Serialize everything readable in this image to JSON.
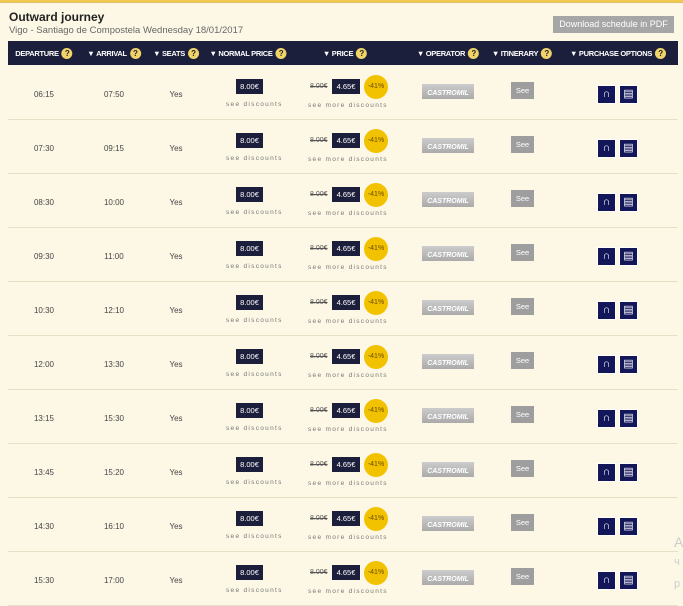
{
  "header": {
    "title": "Outward journey",
    "subtitle": "Vigo - Santiago de Compostela Wednesday 18/01/2017",
    "pdf_button": "Download schedule in PDF"
  },
  "columns": [
    "DEPARTURE",
    "ARRIVAL",
    "SEATS",
    "NORMAL PRICE",
    "PRICE",
    "OPERATOR",
    "ITINERARY",
    "PURCHASE OPTIONS"
  ],
  "help_glyph": "?",
  "rows": [
    {
      "departure": "06:15",
      "arrival": "07:50",
      "seats": "Yes",
      "normal_price": "8.00€",
      "old_price": "8.00€",
      "price": "4.65€",
      "discount": "-41%",
      "operator": "CASTROMIL",
      "itinerary": "See"
    },
    {
      "departure": "07:30",
      "arrival": "09:15",
      "seats": "Yes",
      "normal_price": "8.00€",
      "old_price": "8.00€",
      "price": "4.65€",
      "discount": "-41%",
      "operator": "CASTROMIL",
      "itinerary": "See"
    },
    {
      "departure": "08:30",
      "arrival": "10:00",
      "seats": "Yes",
      "normal_price": "8.00€",
      "old_price": "8.00€",
      "price": "4.65€",
      "discount": "-41%",
      "operator": "CASTROMIL",
      "itinerary": "See"
    },
    {
      "departure": "09:30",
      "arrival": "11:00",
      "seats": "Yes",
      "normal_price": "8.00€",
      "old_price": "8.00€",
      "price": "4.65€",
      "discount": "-41%",
      "operator": "CASTROMIL",
      "itinerary": "See"
    },
    {
      "departure": "10:30",
      "arrival": "12:10",
      "seats": "Yes",
      "normal_price": "8.00€",
      "old_price": "8.00€",
      "price": "4.65€",
      "discount": "-41%",
      "operator": "CASTROMIL",
      "itinerary": "See"
    },
    {
      "departure": "12:00",
      "arrival": "13:30",
      "seats": "Yes",
      "normal_price": "8.00€",
      "old_price": "8.00€",
      "price": "4.65€",
      "discount": "-41%",
      "operator": "CASTROMIL",
      "itinerary": "See"
    },
    {
      "departure": "13:15",
      "arrival": "15:30",
      "seats": "Yes",
      "normal_price": "8.00€",
      "old_price": "8.00€",
      "price": "4.65€",
      "discount": "-41%",
      "operator": "CASTROMIL",
      "itinerary": "See"
    },
    {
      "departure": "13:45",
      "arrival": "15:20",
      "seats": "Yes",
      "normal_price": "8.00€",
      "old_price": "8.00€",
      "price": "4.65€",
      "discount": "-41%",
      "operator": "CASTROMIL",
      "itinerary": "See"
    },
    {
      "departure": "14:30",
      "arrival": "16:10",
      "seats": "Yes",
      "normal_price": "8.00€",
      "old_price": "8.00€",
      "price": "4.65€",
      "discount": "-41%",
      "operator": "CASTROMIL",
      "itinerary": "See"
    },
    {
      "departure": "15:30",
      "arrival": "17:00",
      "seats": "Yes",
      "normal_price": "8.00€",
      "old_price": "8.00€",
      "price": "4.65€",
      "discount": "-41%",
      "operator": "CASTROMIL",
      "itinerary": "See"
    }
  ],
  "see_discounts": "see discounts",
  "see_more_discounts": "see more discounts",
  "ghost_text": [
    "A",
    "ч",
    "p"
  ]
}
